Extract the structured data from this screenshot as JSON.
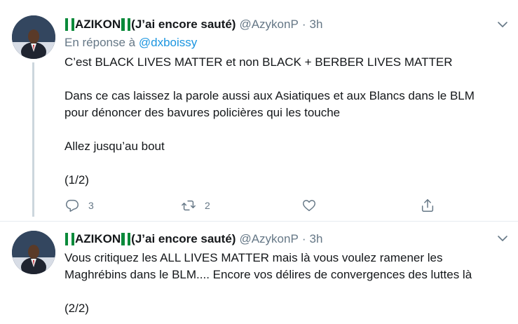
{
  "tweets": [
    {
      "display_name": "AZIKON",
      "display_name_suffix": "(J’ai encore sauté)",
      "handle": "@AzykonP",
      "separator": "·",
      "time": "3h",
      "reply_prefix": "En réponse à",
      "reply_to": "@dxboissy",
      "lines": [
        "C’est BLACK LIVES MATTER et non BLACK + BERBER LIVES MATTER",
        "Dans ce cas laissez la parole aussi aux Asiatiques et aux Blancs dans le BLM",
        "pour dénoncer des bavures policières qui les touche",
        "Allez jusqu’au bout",
        "(1/2)"
      ],
      "reply_count": "3",
      "retweet_count": "2"
    },
    {
      "display_name": "AZIKON",
      "display_name_suffix": "(J’ai encore sauté)",
      "handle": "@AzykonP",
      "separator": "·",
      "time": "3h",
      "lines": [
        "Vous critiquez les ALL LIVES MATTER mais là vous voulez ramener les",
        "Maghrébins dans le BLM.... Encore vos délires de convergences des luttes là",
        "(2/2)"
      ]
    }
  ],
  "colors": {
    "text": "#14171a",
    "muted": "#657786",
    "link": "#1b95e0",
    "thread_line": "#ccd6dd",
    "flag_green": "#0a8a3a"
  },
  "icons": {
    "reply": "reply-icon",
    "retweet": "retweet-icon",
    "like": "heart-icon",
    "share": "share-icon",
    "more": "chevron-down-icon",
    "flag": "nigeria-flag-icon"
  }
}
